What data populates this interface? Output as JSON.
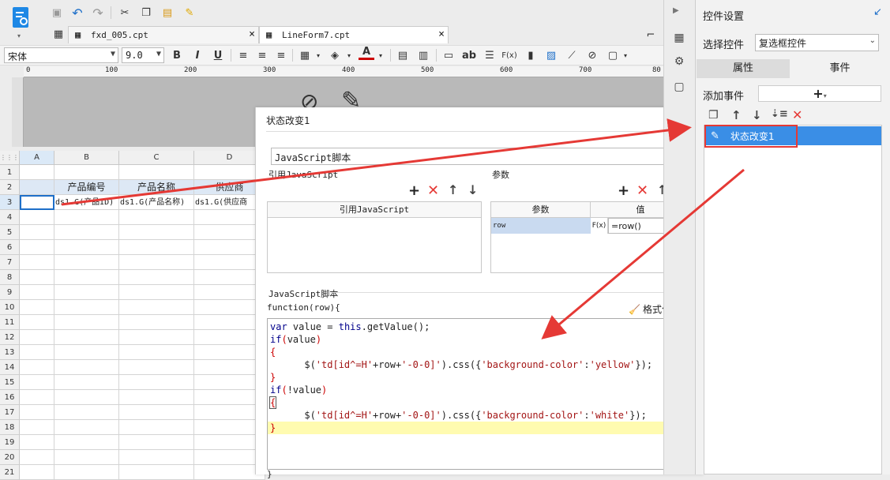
{
  "tabs": [
    {
      "label": "fxd_005.cpt",
      "close": "×"
    },
    {
      "label": "LineForm7.cpt",
      "close": "×"
    }
  ],
  "font": {
    "family": "宋体",
    "size": "9.0"
  },
  "format_buttons": [
    "B",
    "I",
    "U"
  ],
  "misc_glyphs": {
    "ab": "ab",
    "fx": "F(x)"
  },
  "ruler_ticks": [
    "0",
    "100",
    "200",
    "300",
    "400",
    "500",
    "600",
    "700",
    "80"
  ],
  "grid": {
    "columns": [
      "A",
      "B",
      "C",
      "D"
    ],
    "rows": [
      "1",
      "2",
      "3",
      "4",
      "5",
      "6",
      "7",
      "8",
      "9",
      "10",
      "11",
      "12",
      "13",
      "14",
      "15",
      "16",
      "17",
      "18",
      "19",
      "20",
      "21"
    ],
    "row2": [
      "",
      "产品编号",
      "产品名称",
      "供应商"
    ],
    "row3": [
      "",
      "ds1.G(产品ID)",
      "ds1.G(产品名称)",
      "ds1.G(供应商"
    ]
  },
  "dialog": {
    "title": "状态改变1",
    "script_type": "JavaScript脚本",
    "ref_section": "引用JavaScript",
    "param_section": "参数",
    "ref_header": "引用JavaScript",
    "param_headers": [
      "参数",
      "值"
    ],
    "param_row": {
      "name": "row",
      "fx": "F(x)",
      "value": "=row()"
    },
    "script_section": "JavaScript脚本",
    "function_sig": "function(row){",
    "format_code": "格式化代码",
    "closing_brace": "}",
    "code_lines": [
      "var value = this.getValue();",
      "if(value)",
      "{",
      "      $('td[id^=H'+row+'-0-0]').css({'background-color':'yellow'});",
      "}",
      "if(!value)",
      "{",
      "      $('td[id^=H'+row+'-0-0]').css({'background-color':'white'});",
      "}"
    ]
  },
  "right_panel": {
    "title": "控件设置",
    "select_label": "选择控件",
    "select_value": "复选框控件",
    "tab_properties": "属性",
    "tab_events": "事件",
    "add_event_label": "添加事件",
    "add_button": "+",
    "event_item": "状态改变1"
  },
  "colors": {
    "selected": "#3a8ee6",
    "highlight_line": "#fffbb0",
    "arrow": "#e53935"
  }
}
